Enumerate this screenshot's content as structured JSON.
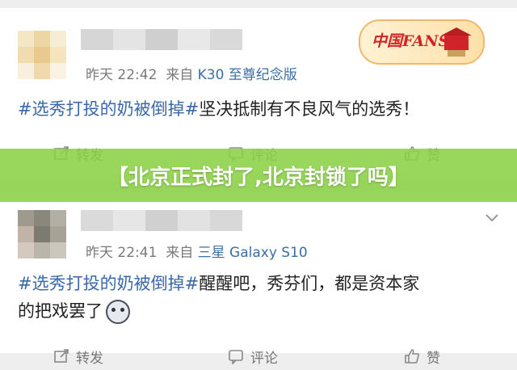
{
  "posts": [
    {
      "meta_time": "昨天 22:42",
      "meta_from": "来自",
      "meta_source": "K30 至尊纪念版",
      "hashtag": "#选秀打投的奶被倒掉#",
      "text": "坚决抵制有不良风气的选秀！",
      "actions": {
        "repost": "转发",
        "comment": "评论",
        "like": "赞"
      }
    },
    {
      "meta_time": "昨天 22:41",
      "meta_from": "来自",
      "meta_source": "三星 Galaxy S10",
      "hashtag": "#选秀打投的奶被倒掉#",
      "text_line1": "醒醒吧，秀芬们，都是资本家",
      "text_line2": "的把戏罢了",
      "emoji": "dog-face-emoji",
      "actions": {
        "repost": "转发",
        "comment": "评论",
        "like": "赞"
      }
    }
  ],
  "badge": {
    "label": "中国FANS"
  },
  "banner": {
    "title": "【北京正式封了,北京封锁了吗】"
  },
  "colors": {
    "banner": "#8bd046",
    "hashtag": "#3a68a8",
    "source": "#3b6ea5"
  }
}
